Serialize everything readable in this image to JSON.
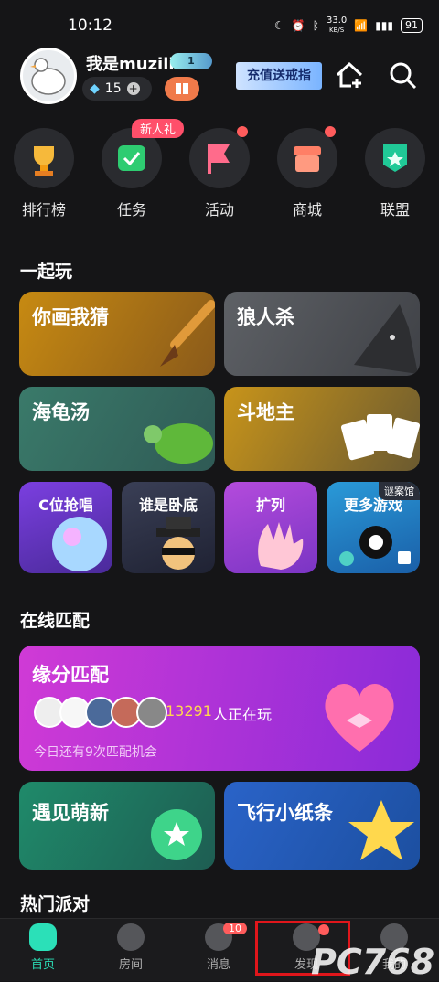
{
  "status": {
    "time": "10:12",
    "net_speed": "33.0",
    "net_unit": "KB/S",
    "battery": "91"
  },
  "user": {
    "name": "我是muzili",
    "level": "1",
    "gems": "15"
  },
  "promo": "充值送戒指",
  "shortcuts": [
    {
      "label": "排行榜"
    },
    {
      "label": "任务",
      "badge": "新人礼"
    },
    {
      "label": "活动"
    },
    {
      "label": "商城"
    },
    {
      "label": "联盟"
    }
  ],
  "play_section": {
    "title": "一起玩",
    "games": [
      "你画我猜",
      "狼人杀",
      "海龟汤",
      "斗地主"
    ],
    "small_games": [
      "C位抢唱",
      "谁是卧底",
      "扩列",
      "更多游戏"
    ],
    "small_badge": "谜案馆"
  },
  "match_section": {
    "title": "在线匹配",
    "main_title": "缘分匹配",
    "online_count": "13291",
    "online_suffix": "人正在玩",
    "chances": "今日还有9次匹配机会",
    "card2": "遇见萌新",
    "card3": "飞行小纸条"
  },
  "party_section": {
    "title": "热门派对"
  },
  "nav": [
    {
      "label": "首页"
    },
    {
      "label": "房间"
    },
    {
      "label": "消息",
      "badge": "10"
    },
    {
      "label": "发现"
    },
    {
      "label": "我的"
    }
  ],
  "watermark": "PC768",
  "colors": {
    "accent": "#2be0b8",
    "badge": "#ff5c5c",
    "purple": "#c23bd4"
  }
}
